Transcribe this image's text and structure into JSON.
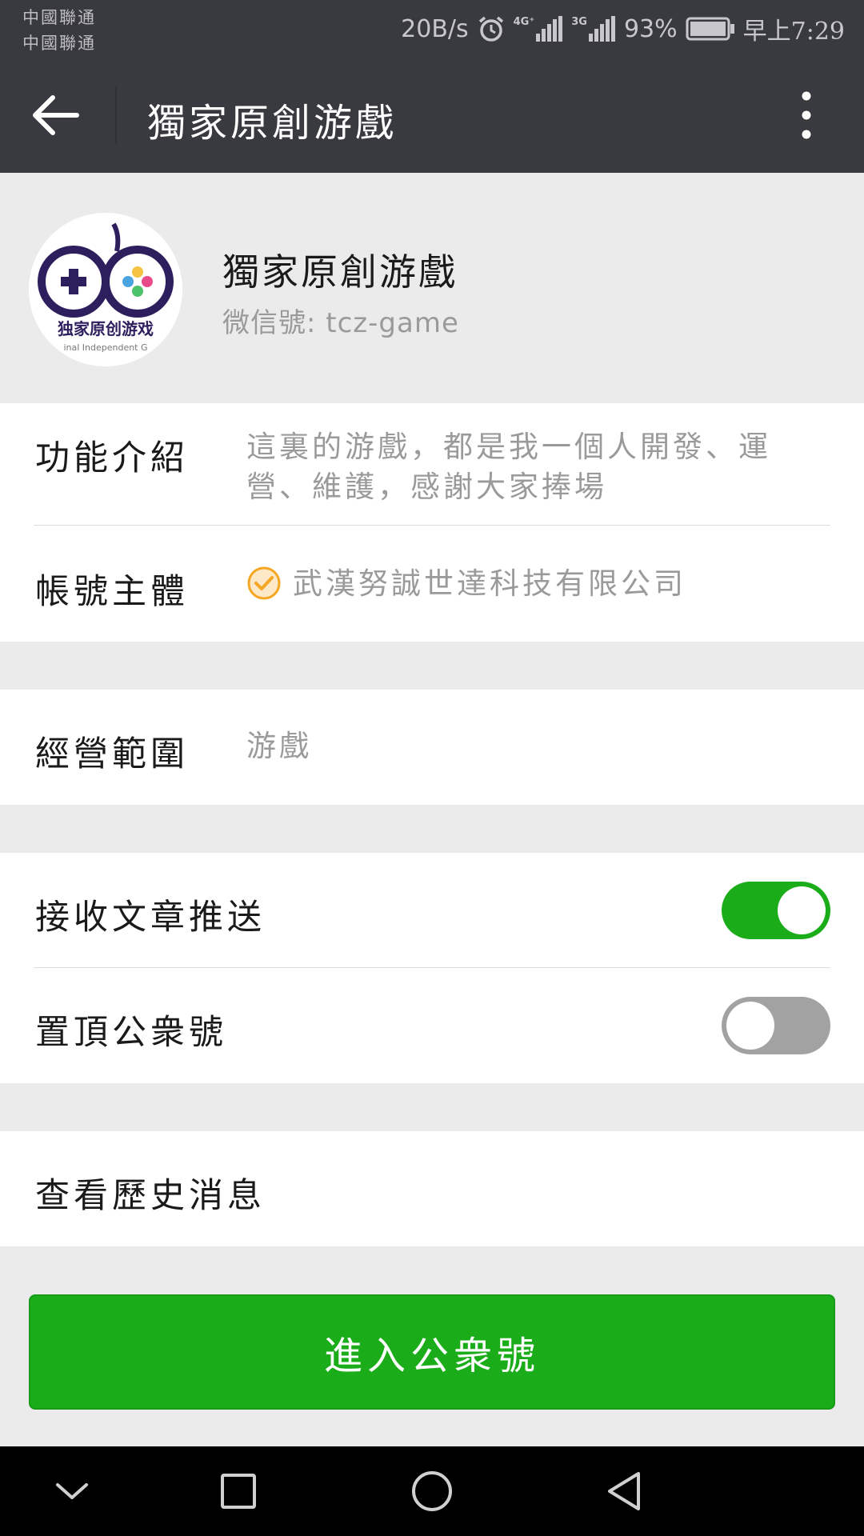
{
  "status_bar": {
    "carrier_1": "中國聯通",
    "carrier_2": "中國聯通",
    "net_speed": "20B/s",
    "network_1": "4G⁺",
    "network_2": "3G",
    "battery": "93%",
    "time": "早上7:29"
  },
  "title_bar": {
    "title": "獨家原創游戲"
  },
  "profile": {
    "name": "獨家原創游戲",
    "wechat_id": "微信號: tcz-game",
    "avatar_text": "独家原创游戏",
    "avatar_subtext": "inal Independent G"
  },
  "info": {
    "intro_label": "功能介紹",
    "intro_line_1": "這裏的游戲，都是我一個人開發、運",
    "intro_line_2": "營、維護，感謝大家捧場",
    "owner_label": "帳號主體",
    "owner_value": "武漢努誠世達科技有限公司"
  },
  "scope": {
    "label": "經營範圍",
    "value": "游戲"
  },
  "settings": {
    "receive_label": "接收文章推送",
    "receive_on": true,
    "pin_label": "置頂公衆號",
    "pin_on": false
  },
  "history": {
    "label": "查看歷史消息"
  },
  "enter_button": {
    "label": "進入公衆號"
  },
  "colors": {
    "header_bg": "#393a3f",
    "accent_green": "#1aad19",
    "page_bg": "#ebebeb",
    "verified_orange": "#f5a623"
  }
}
